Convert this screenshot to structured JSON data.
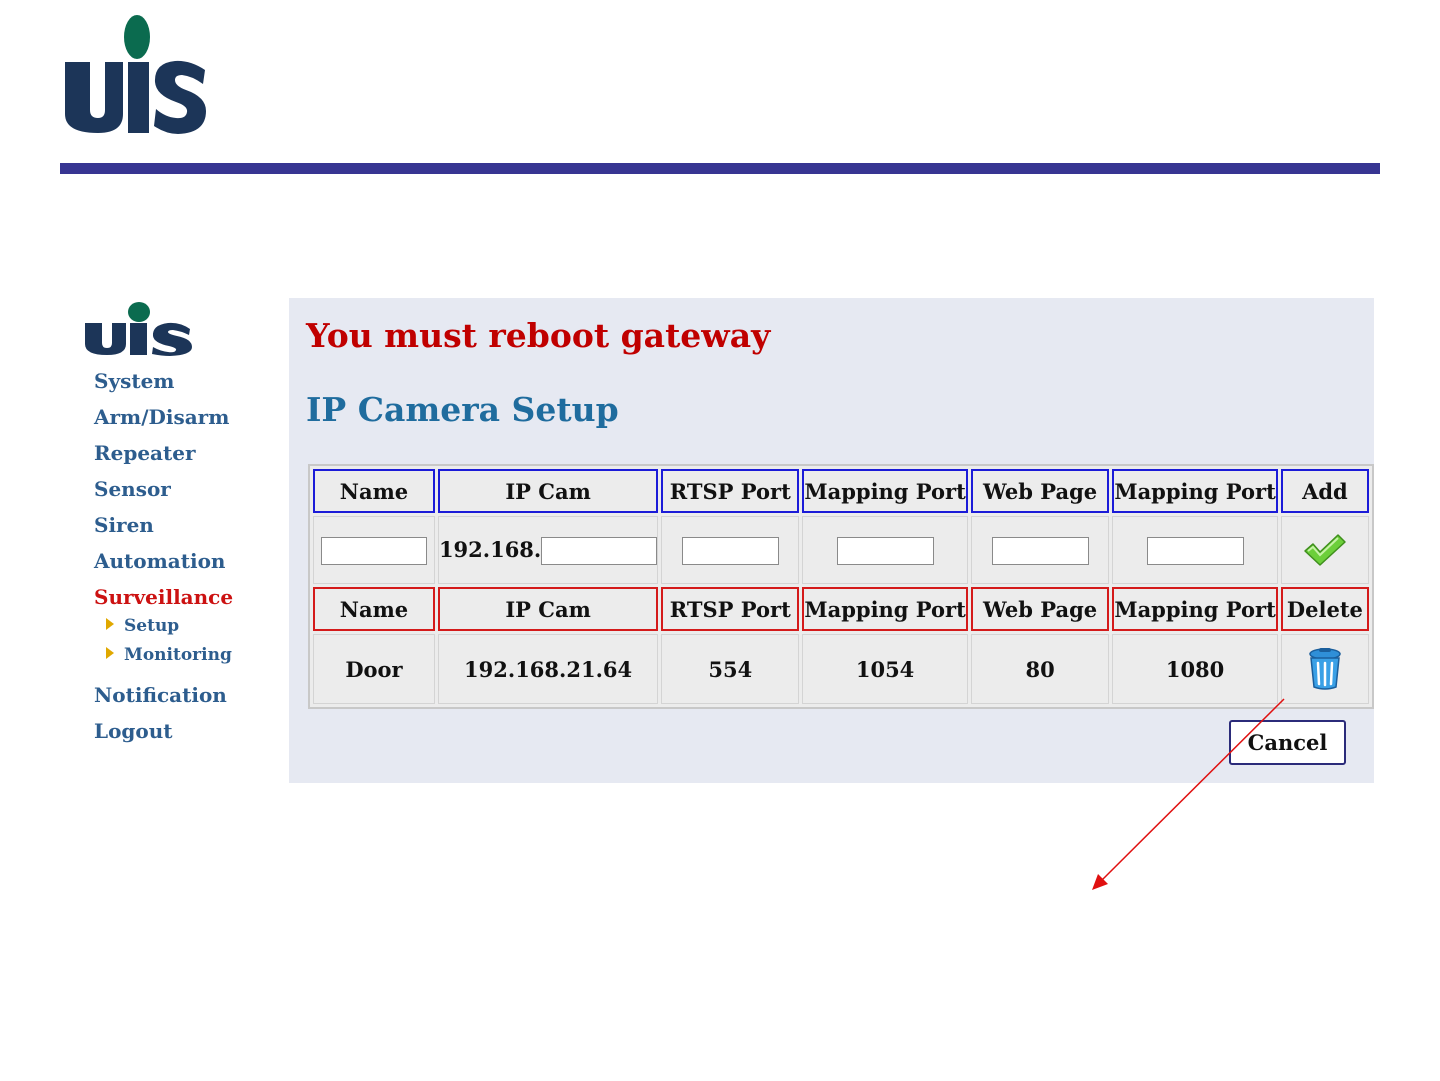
{
  "header": {
    "logo_text": "UIS"
  },
  "sidebar": {
    "logo_text": "UIS",
    "items": [
      {
        "label": "System",
        "active": false
      },
      {
        "label": "Arm/Disarm",
        "active": false
      },
      {
        "label": "Repeater",
        "active": false
      },
      {
        "label": "Sensor",
        "active": false
      },
      {
        "label": "Siren",
        "active": false
      },
      {
        "label": "Automation",
        "active": false
      },
      {
        "label": "Surveillance",
        "active": true
      }
    ],
    "subitems": [
      {
        "label": "Setup"
      },
      {
        "label": "Monitoring"
      }
    ],
    "items_after": [
      {
        "label": "Notification"
      },
      {
        "label": "Logout"
      }
    ]
  },
  "main": {
    "alert": "You must reboot gateway",
    "title": "IP Camera Setup",
    "add_headers": [
      "Name",
      "IP Cam",
      "RTSP Port",
      "Mapping Port",
      "Web Page",
      "Mapping Port",
      "Add"
    ],
    "ip_prefix": "192.168.",
    "inputs": {
      "name": "",
      "ip_suffix": "",
      "rtsp_port": "",
      "mapping_port": "",
      "web_page": "",
      "web_mapping_port": ""
    },
    "list_headers": [
      "Name",
      "IP Cam",
      "RTSP Port",
      "Mapping Port",
      "Web Page",
      "Mapping Port",
      "Delete"
    ],
    "cameras": [
      {
        "name": "Door",
        "ip": "192.168.21.64",
        "rtsp_port": "554",
        "mapping_port": "1054",
        "web_page": "80",
        "web_mapping_port": "1080"
      }
    ],
    "cancel_label": "Cancel"
  },
  "icons": {
    "add": "checkmark-icon",
    "delete": "trash-icon"
  },
  "colors": {
    "header_rule": "#373592",
    "alert": "#c00000",
    "title": "#1f6c9e",
    "nav": "#2d5d8e",
    "nav_active": "#cc1111",
    "add_header_border": "#1b1bd8",
    "list_header_border": "#d41a1a",
    "annotation_arrow": "#e01010"
  }
}
